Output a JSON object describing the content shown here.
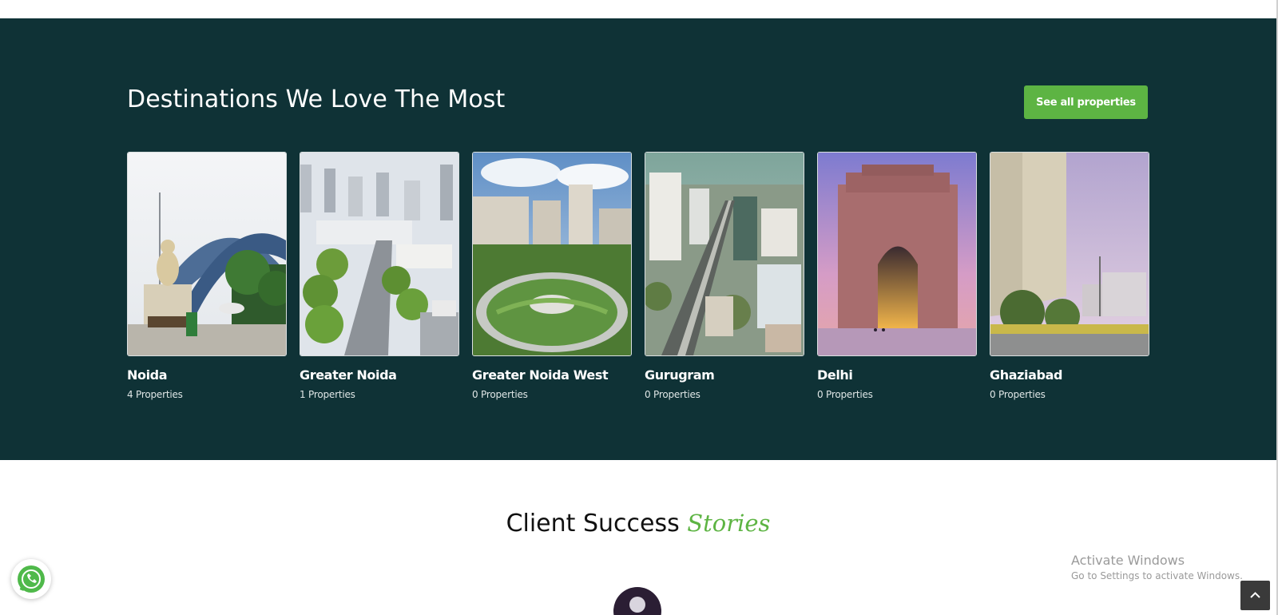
{
  "destinations": {
    "title": "Destinations We Love The Most",
    "see_all_label": "See all properties",
    "cards": [
      {
        "name": "Noida",
        "count": "4 Properties",
        "image": "noida-welcome-arch-photo"
      },
      {
        "name": "Greater Noida",
        "count": "1 Properties",
        "image": "greater-noida-aerial-photo"
      },
      {
        "name": "Greater Noida West",
        "count": "0 Properties",
        "image": "greater-noida-west-roundabout-photo"
      },
      {
        "name": "Gurugram",
        "count": "0 Properties",
        "image": "gurugram-skyline-photo"
      },
      {
        "name": "Delhi",
        "count": "0 Properties",
        "image": "delhi-india-gate-photo"
      },
      {
        "name": "Ghaziabad",
        "count": "0 Properties",
        "image": "ghaziabad-highrise-photo"
      }
    ]
  },
  "stories": {
    "heading_main": "Client Success",
    "heading_accent": "Stories"
  },
  "os_overlay": {
    "line1": "Activate Windows",
    "line2": "Go to Settings to activate Windows."
  },
  "colors": {
    "section_bg": "#0f3236",
    "accent_green": "#5db443"
  },
  "icons": {
    "whatsapp": "whatsapp-icon",
    "back_to_top": "chevron-up-icon",
    "avatar": "user-avatar-icon"
  }
}
